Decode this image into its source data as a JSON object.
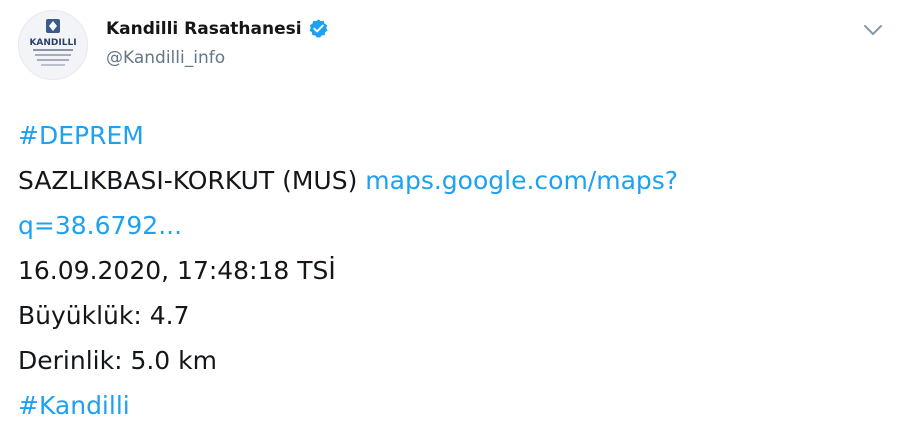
{
  "colors": {
    "link": "#1da1f2",
    "text": "#14171a",
    "muted": "#657786",
    "verified": "#1da1f2"
  },
  "author": {
    "display_name": "Kandilli Rasathanesi",
    "handle": "@Kandilli_info",
    "verified_icon": "verified-badge-icon",
    "avatar_logo_text": "KANDILLI"
  },
  "menu_icon": "chevron-down-icon",
  "tweet": {
    "hashtag_1": "#DEPREM",
    "location": "SAZLIKBASI-KORKUT (MUS)",
    "link_part_1": "maps.google.com/maps?",
    "link_part_2": "q=38.6792...",
    "datetime": "16.09.2020, 17:48:18 TSİ",
    "magnitude": "Büyüklük: 4.7",
    "depth": "Derinlik: 5.0 km",
    "hashtag_2": "#Kandilli"
  }
}
